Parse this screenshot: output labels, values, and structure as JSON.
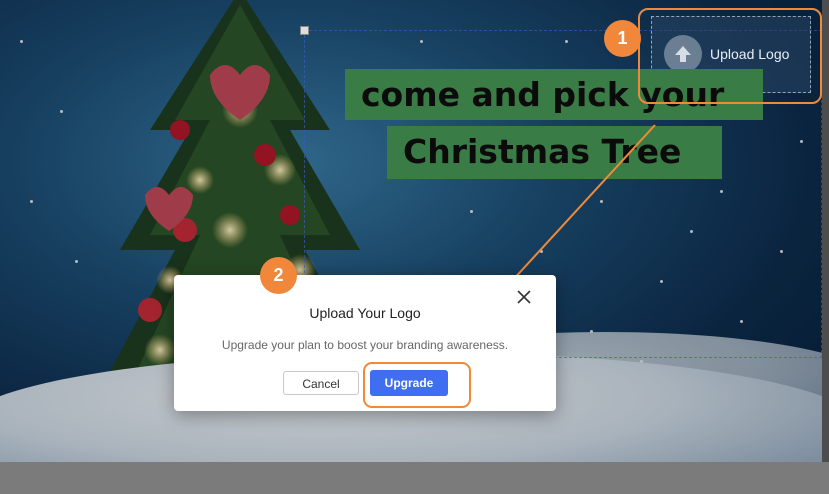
{
  "poster": {
    "title_line1": "come and pick your",
    "title_line2": "Christmas Tree",
    "logo_placeholder_label": "Upload Logo",
    "title_band_color": "#3a7c46"
  },
  "annotations": {
    "step1": "1",
    "step2": "2",
    "accent_color": "#f0873a"
  },
  "dialog": {
    "title": "Upload Your Logo",
    "message": "Upgrade your plan to boost your branding awareness.",
    "cancel_label": "Cancel",
    "upgrade_label": "Upgrade",
    "upgrade_color": "#3f6ef0"
  }
}
